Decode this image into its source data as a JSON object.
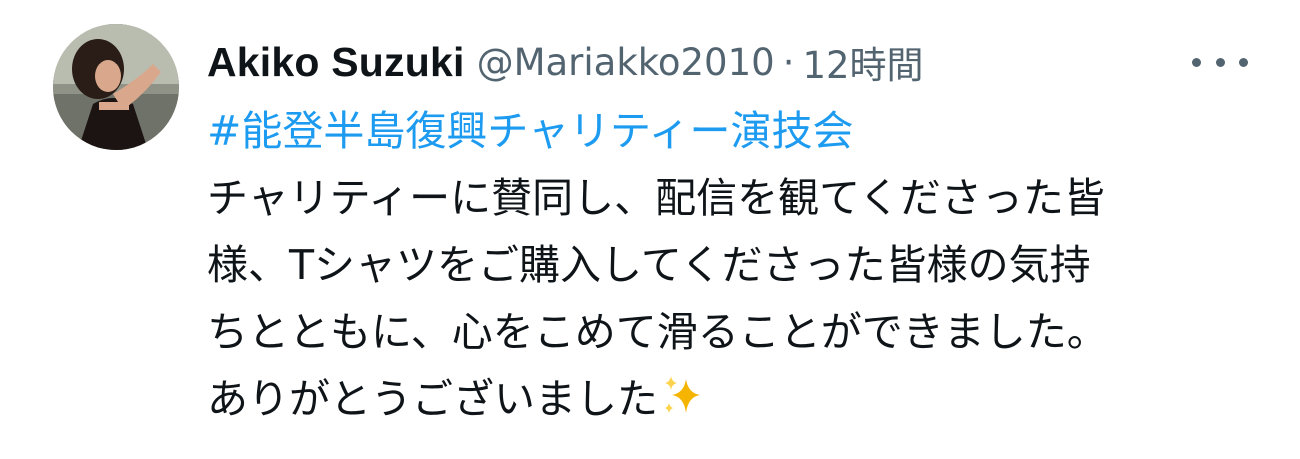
{
  "tweet": {
    "display_name": "Akiko Suzuki",
    "handle": "@Mariakko2010",
    "separator": "·",
    "timestamp": "12時間",
    "hashtag": "#能登半島復興チャリティー演技会",
    "text_lines": [
      "チャリティーに賛同し、配信を観てくださった皆",
      "様、Tシャツをご購入してくださった皆様の気持",
      "ちとともに、心をこめて滑ることができました。",
      "ありがとうございました"
    ],
    "emoji": "sparkles-emoji",
    "more_icon": "more-options-icon"
  },
  "colors": {
    "text": "#0f1419",
    "secondary": "#536471",
    "link": "#1d9bf0",
    "sparkle": "#f4b400"
  }
}
